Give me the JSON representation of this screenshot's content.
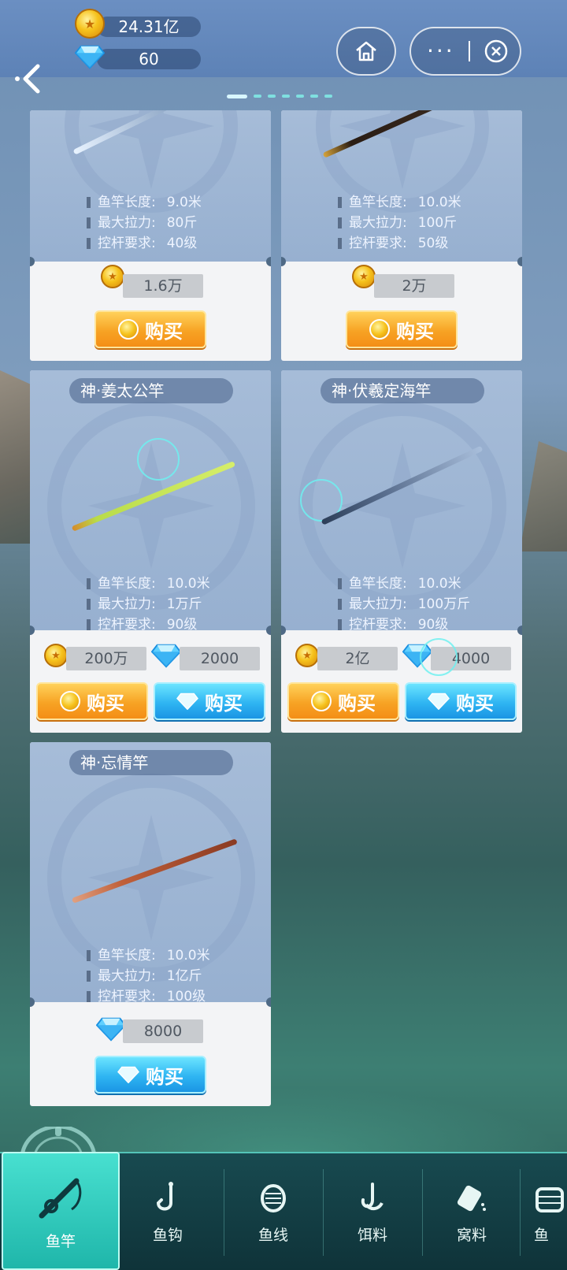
{
  "header": {
    "gold_amount": "24.31亿",
    "gem_amount": "60",
    "home_icon": "home-icon",
    "more_icon": "more-dots-icon",
    "close_icon": "close-circle-icon",
    "back_icon": "back-arrow-icon",
    "page_count": 7,
    "active_page": 1
  },
  "labels": {
    "length": "鱼竿长度:",
    "pull": "最大拉力:",
    "level": "控杆要求:",
    "buy": "购买"
  },
  "cards": [
    {
      "title": "",
      "length": "9.0米",
      "pull": "80斤",
      "level": "40级",
      "gold_price": "1.6万",
      "rod_color": "#aac6e8"
    },
    {
      "title": "",
      "length": "10.0米",
      "pull": "100斤",
      "level": "50级",
      "gold_price": "2万",
      "rod_color": "#3a2a20"
    },
    {
      "title": "神·姜太公竿",
      "length": "10.0米",
      "pull": "1万斤",
      "level": "90级",
      "gold_price": "200万",
      "gem_price": "2000",
      "rod_color": "#b9dc4a"
    },
    {
      "title": "神·伏羲定海竿",
      "length": "10.0米",
      "pull": "100万斤",
      "level": "90级",
      "gold_price": "2亿",
      "gem_price": "4000",
      "rod_color": "#5a6f8f"
    },
    {
      "title": "神·忘情竿",
      "length": "10.0米",
      "pull": "1亿斤",
      "level": "100级",
      "gem_price": "8000",
      "rod_color": "#c0603a"
    }
  ],
  "tabs": [
    {
      "label": "鱼竿",
      "icon": "fishing-rod-icon",
      "active": true
    },
    {
      "label": "鱼钩",
      "icon": "fish-hook-icon",
      "active": false
    },
    {
      "label": "鱼线",
      "icon": "fishing-line-spool-icon",
      "active": false
    },
    {
      "label": "饵料",
      "icon": "bait-icon",
      "active": false
    },
    {
      "label": "窝料",
      "icon": "groundbait-bag-icon",
      "active": false
    },
    {
      "label": "鱼",
      "icon": "fish-basket-icon",
      "active": false
    }
  ],
  "colors": {
    "accent_teal": "#2fc8b8",
    "gold_button": "#f7a324",
    "blue_button": "#2fb5f2"
  }
}
